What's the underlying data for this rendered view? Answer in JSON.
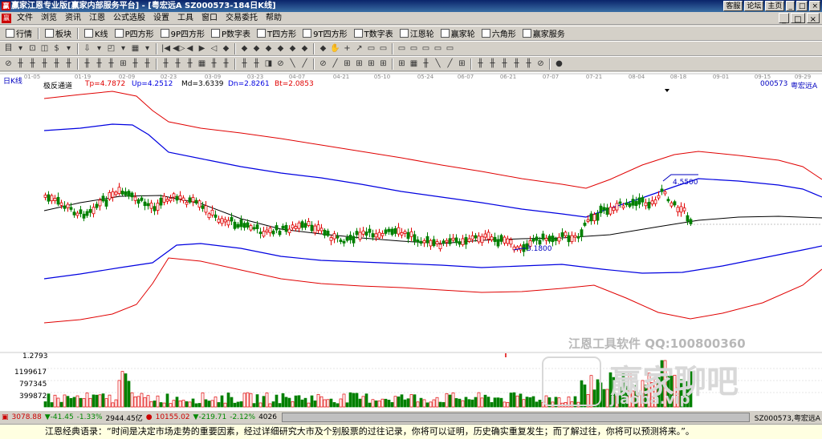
{
  "window": {
    "title": "赢家江恩专业版[赢家内部服务平台] - [粤宏远A  SZ000573-184日K线]",
    "buttons": [
      "客服",
      "论坛",
      "主页",
      "_",
      "□",
      "×"
    ]
  },
  "menu": {
    "icon": "赢",
    "items": [
      "文件",
      "浏览",
      "资讯",
      "江恩",
      "公式选股",
      "设置",
      "工具",
      "窗口",
      "交易委托",
      "帮助"
    ],
    "right_buttons": [
      "_",
      "□",
      "×"
    ]
  },
  "toolbar1": [
    {
      "icon": "grid-icon",
      "label": "行情"
    },
    {
      "icon": "block-icon",
      "label": "板块"
    },
    {
      "icon": "kline-icon",
      "label": "K线"
    },
    {
      "icon": "p-icon",
      "label": "P四方形"
    },
    {
      "icon": "9p-icon",
      "label": "9P四方形"
    },
    {
      "icon": "p-icon",
      "label": "P数字表"
    },
    {
      "icon": "t-icon",
      "label": "T四方形"
    },
    {
      "icon": "9t-icon",
      "label": "9T四方形"
    },
    {
      "icon": "tn-icon",
      "label": "T数字表"
    },
    {
      "icon": "circle-icon",
      "label": "江恩轮"
    },
    {
      "icon": "circle-icon",
      "label": "赢家轮"
    },
    {
      "icon": "star-icon",
      "label": "六角形"
    },
    {
      "icon": "service-icon",
      "label": "赢家服务"
    }
  ],
  "toolbar2_glyphs": [
    "目",
    "▾",
    "⊡",
    "◫",
    "$",
    "▾",
    "⇩",
    "▾",
    "◰",
    "▾",
    "▦",
    "▾",
    "|◀",
    "◀▷",
    "◀",
    "▶",
    "◁",
    "◆",
    "◆",
    "◆",
    "◆",
    "◆",
    "◆",
    "◆",
    "◆",
    "✋",
    "+",
    "↗",
    "▭",
    "▭",
    "▭",
    "▭",
    "▭",
    "▭",
    "▭"
  ],
  "toolbar3_glyphs": [
    "⊘",
    "╫",
    "╫",
    "╫",
    "╫",
    "╫",
    "╫",
    "╫",
    "╫",
    "⊞",
    "╫",
    "╫",
    "╫",
    "╫",
    "╫",
    "▦",
    "╫",
    "╫",
    "╫",
    "╫",
    "◨",
    "⊘",
    "╲",
    "╱",
    "⊘",
    "╱",
    "⊞",
    "⊞",
    "⊞",
    "⊞",
    "⊞",
    "▦",
    "╫",
    "╲",
    "╱",
    "⊞",
    "╫",
    "╫",
    "╫",
    "╫",
    "╫",
    "⊘",
    "●"
  ],
  "chart": {
    "period_label": "日K线",
    "indicator": "极反通道",
    "tp": "Tp=4.7872",
    "up": "Up=4.2512",
    "md": "Md=3.6339",
    "dn": "Dn=2.8261",
    "bt": "Bt=2.0853",
    "stock": "000573",
    "stock_name": "粤宏远A",
    "date_ticks": [
      "01-05",
      "01-19",
      "02-09",
      "02-23",
      "03-09",
      "03-23",
      "04-07",
      "04-21",
      "05-10",
      "05-24",
      "06-07",
      "06-21",
      "07-07",
      "07-21",
      "08-04",
      "08-18",
      "09-01",
      "09-15",
      "09-29"
    ],
    "high_label": "4.5500",
    "low_label": "3.1800",
    "vol_axis": [
      "1.2793",
      "1199617",
      "797345",
      "399872"
    ],
    "watermark_1": "江恩工具软件  QQ:100800360",
    "watermark_2": "赢家聊吧",
    "watermark_3": "jiaoba.vip"
  },
  "chart_data": {
    "type": "candlestick",
    "title": "极反通道",
    "channels": {
      "Tp": 4.7872,
      "Up": 4.2512,
      "Md": 3.6339,
      "Dn": 2.8261,
      "Bt": 2.0853
    },
    "annotations": [
      {
        "label": "4.5500",
        "type": "high"
      },
      {
        "label": "3.1800",
        "type": "low"
      }
    ],
    "x_ticks": [
      "01-05",
      "01-19",
      "02-09",
      "02-23",
      "03-09",
      "03-23",
      "04-07",
      "04-21",
      "05-10",
      "05-24",
      "06-07",
      "06-21",
      "07-07",
      "07-21",
      "08-04",
      "08-18",
      "09-01",
      "09-15",
      "09-29"
    ],
    "volume_axis": [
      1199617,
      797345,
      399872
    ]
  },
  "status": {
    "sh_index": "3078.88",
    "sh_change": "▼-41.45",
    "sh_pct": "-1.33%",
    "sh_amount": "2944.45亿",
    "sz_index": "10155.02",
    "sz_change": "▼-219.71",
    "sz_pct": "-2.12%",
    "sz_amount": "4026",
    "right": "SZ000573,粤宏远A"
  },
  "quote": "江恩经典语录：“时间是决定市场走势的重要因素，经过详细研究大市及个别股票的过往记录，你将可以证明，历史确实重复发生；而了解过往，你将可以预测将来。”。",
  "colors": {
    "up": "#e00000",
    "down": "#008000",
    "channel_outer": "#e00000",
    "channel_inner": "#0000e0",
    "mid": "#000000"
  }
}
